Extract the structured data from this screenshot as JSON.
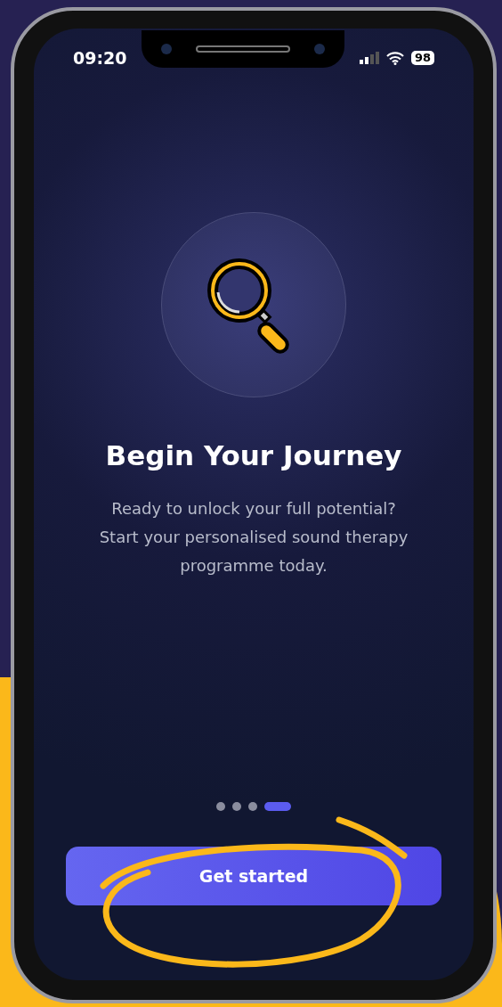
{
  "status_bar": {
    "time": "09:20",
    "battery": "98"
  },
  "title": "Begin Your Journey",
  "body": "Ready to unlock your full potential?\nStart your personalised sound therapy\nprogramme today.",
  "pagination": [
    {
      "selected": false
    },
    {
      "selected": false
    },
    {
      "selected": false
    },
    {
      "selected": true
    }
  ],
  "button": {
    "label": "Get started"
  }
}
